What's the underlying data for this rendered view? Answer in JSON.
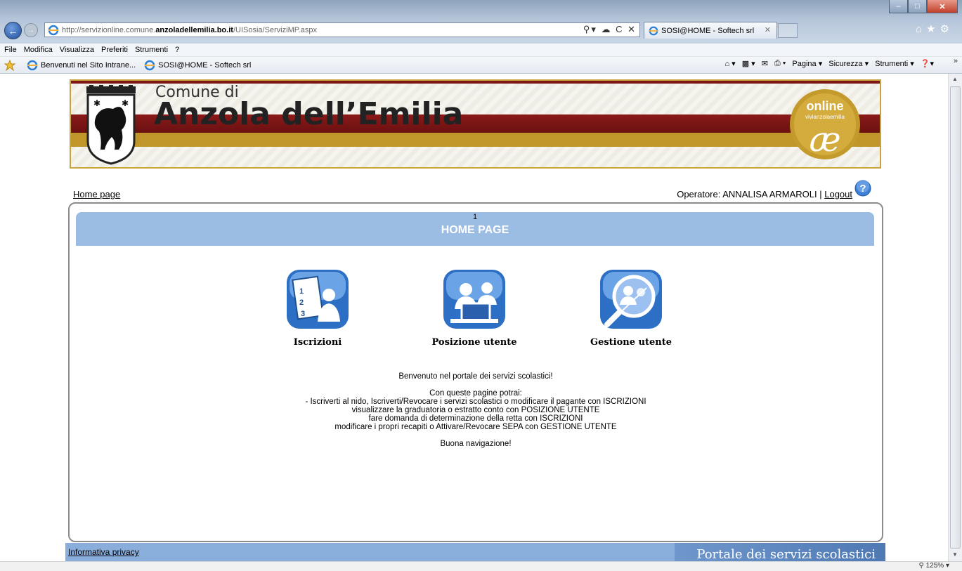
{
  "browser": {
    "url_prefix": "http://servizionline.comune.",
    "url_domain": "anzoladellemilia.bo.it",
    "url_path": "/UISosia/ServiziMP.aspx",
    "tab_title": "SOSI@HOME - Softech srl",
    "menu": [
      "File",
      "Modifica",
      "Visualizza",
      "Preferiti",
      "Strumenti",
      "?"
    ],
    "favorites": [
      "Benvenuti nel Sito Intrane...",
      "SOSI@HOME - Softech srl"
    ],
    "commands": [
      "Pagina ▾",
      "Sicurezza ▾",
      "Strumenti ▾"
    ],
    "zoom": "125%"
  },
  "banner": {
    "comune_di": "Comune di",
    "name": "Anzola dell’Emilia",
    "logo_online": "online",
    "logo_sub": "vivianzolaemilia"
  },
  "nav": {
    "home_link": "Home page",
    "operator_prefix": "Operatore: ANNALISA ARMAROLI | ",
    "logout": "Logout"
  },
  "page": {
    "number": "1",
    "title": "HOME PAGE"
  },
  "services": [
    {
      "label": "Iscrizioni",
      "icon": "enrollment-list-icon"
    },
    {
      "label": "Posizione utente",
      "icon": "user-computer-icon"
    },
    {
      "label": "Gestione utente",
      "icon": "user-search-icon"
    }
  ],
  "welcome": {
    "line1": "Benvenuto nel portale dei servizi scolastici!",
    "line2": "Con queste pagine potrai:",
    "line3": "- Iscriverti al nido, Iscriverti/Revocare i servizi scolastici o modificare il pagante con ISCRIZIONI",
    "line4": "visualizzare la graduatoria o estratto conto con POSIZIONE UTENTE",
    "line5": "fare domanda di determinazione della retta con ISCRIZIONI",
    "line6": "modificare i propri recapiti o Attivare/Revocare SEPA con GESTIONE UTENTE",
    "line7": "Buona navigazione!"
  },
  "footer": {
    "privacy": "Informativa privacy",
    "portal": "Portale dei servizi scolastici"
  },
  "colors": {
    "header_blue": "#9bbce3",
    "footer_blue": "#89aedb",
    "banner_red": "#7d1616",
    "banner_gold": "#c0962a"
  }
}
